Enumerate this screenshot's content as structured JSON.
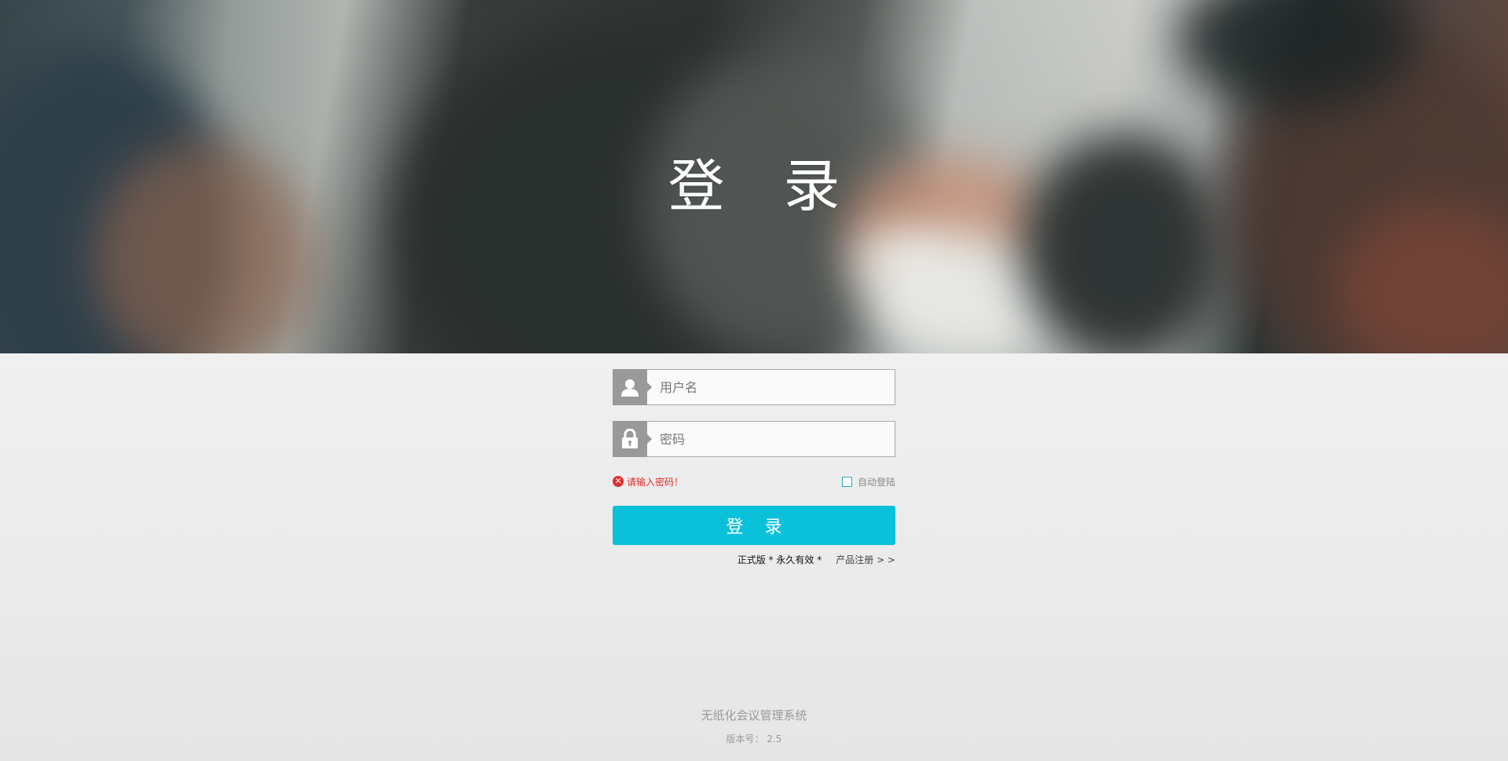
{
  "hero": {
    "title": "登 录"
  },
  "form": {
    "username_placeholder": "用户名",
    "password_placeholder": "密码",
    "error_message": "请输入密码！",
    "auto_login_label": "自动登陆",
    "submit_label": "登 录",
    "license_text": "正式版 * 永久有效 *",
    "register_link": "产品注册 > >"
  },
  "footer": {
    "system_name": "无纸化会议管理系统",
    "version_label": "版本号： 2.5"
  },
  "colors": {
    "accent": "#0bc1da",
    "error": "#e52a2a",
    "icon_bg": "#999999"
  }
}
